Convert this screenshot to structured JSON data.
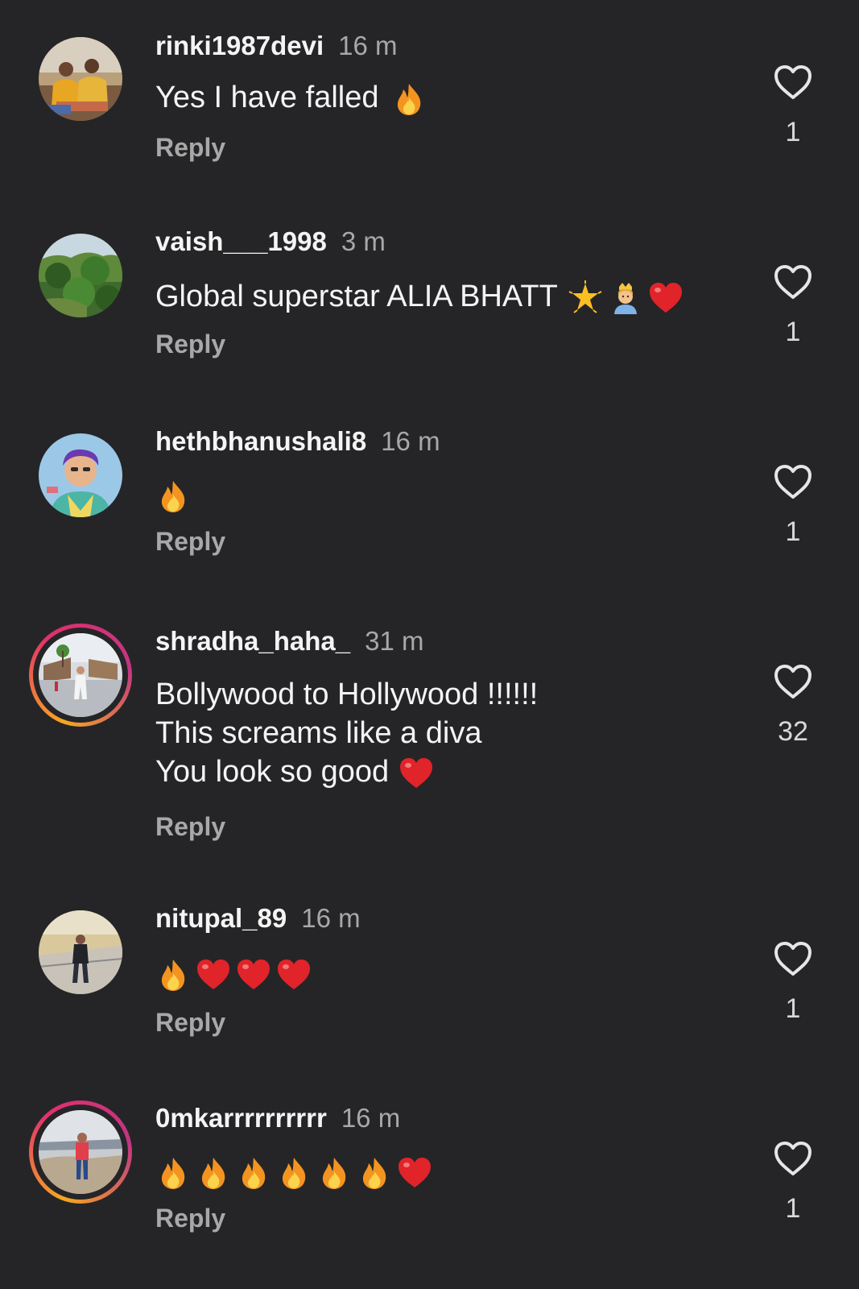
{
  "comments": [
    {
      "username": "rinki1987devi",
      "time": "16 m",
      "lines": [
        "Yes I have falled"
      ],
      "emojis": [
        "fire-emoji"
      ],
      "reply": "Reply",
      "likes": "1",
      "has_story_ring": false
    },
    {
      "username": "vaish___1998",
      "time": "3 m",
      "lines": [
        "Global superstar ALIA BHATT"
      ],
      "emojis": [
        "glowing-star-emoji",
        "princess-emoji",
        "red-heart-emoji"
      ],
      "reply": "Reply",
      "likes": "1",
      "has_story_ring": false
    },
    {
      "username": "hethbhanushali8",
      "time": "16 m",
      "lines": [
        ""
      ],
      "emojis": [
        "fire-emoji"
      ],
      "reply": "Reply",
      "likes": "1",
      "has_story_ring": false
    },
    {
      "username": "shradha_haha_",
      "time": "31 m",
      "lines": [
        "Bollywood to Hollywood !!!!!!",
        "This screams like a diva",
        "You look so good"
      ],
      "emojis": [
        "red-heart-emoji"
      ],
      "reply": "Reply",
      "likes": "32",
      "has_story_ring": true
    },
    {
      "username": "nitupal_89",
      "time": "16 m",
      "lines": [
        ""
      ],
      "emojis": [
        "fire-emoji",
        "red-heart-emoji",
        "red-heart-emoji",
        "red-heart-emoji"
      ],
      "reply": "Reply",
      "likes": "1",
      "has_story_ring": false
    },
    {
      "username": "0mkarrrrrrrrrr",
      "time": "16 m",
      "lines": [
        ""
      ],
      "emojis": [
        "fire-emoji",
        "fire-emoji",
        "fire-emoji",
        "fire-emoji",
        "fire-emoji",
        "fire-emoji",
        "red-heart-emoji"
      ],
      "reply": "Reply",
      "likes": "1",
      "has_story_ring": true
    }
  ],
  "icons": {
    "like": "heart-outline-icon"
  },
  "colors": {
    "background": "#252527",
    "secondary_text": "#a8a8a8",
    "story_ring_orange": "#f5a623",
    "story_ring_pink": "#e1306c"
  }
}
